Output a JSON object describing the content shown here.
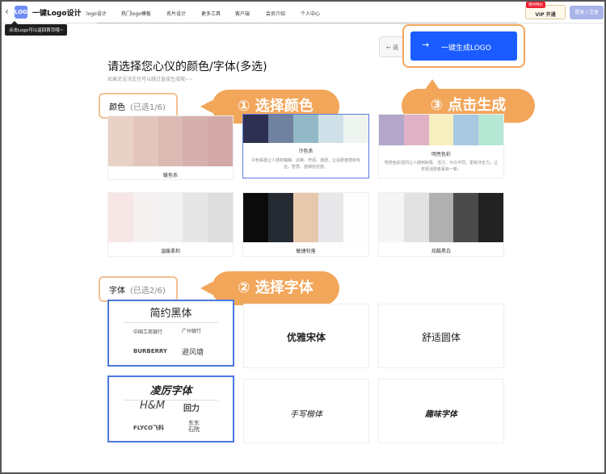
{
  "topbar": {
    "back": "‹",
    "logo_text": "LOGO",
    "brand": "一键Logo设计",
    "nav": [
      "logo设计",
      "热门logo模板",
      "名片设计",
      "更多工具",
      "客户端",
      "会员介绍",
      "个人中心"
    ],
    "tooltip": "点击Logo可以返回首页哦~",
    "vip_tag": "限时特价",
    "vip_label": "VIP 开通",
    "login": "登录 / 注册"
  },
  "actions": {
    "back": "← 返",
    "generate_arrow": "→",
    "generate": "一键生成LOGO"
  },
  "heading": {
    "title": "请选择您心仪的颜色/字体(多选)",
    "subtitle": "如果还没决定也可以跳过直接生成哦~~"
  },
  "color_section": {
    "label": "颜色",
    "count": "(已选1/6)",
    "callout": "① 选择颜色"
  },
  "font_section": {
    "label": "字体",
    "count": "(已选2/6)",
    "callout": "② 选择字体"
  },
  "generate_callout": "③ 点击生成",
  "color_cards": [
    {
      "name": "暖色系",
      "desc": "",
      "selected": false,
      "colors": [
        "#e8d2c5",
        "#e2c6bc",
        "#dbbab4",
        "#d6b0ad",
        "#d3a9a8"
      ]
    },
    {
      "name": "冷色系",
      "desc": "冷色系能让人感到镇静、凉爽、开阔、通透，让消费者感到专业、智慧、值得信任度。",
      "selected": true,
      "colors": [
        "#2d3050",
        "#6f82a0",
        "#93b9c9",
        "#cfe0e8",
        "#eef5f0"
      ]
    },
    {
      "name": "明亮色彩",
      "desc": "明亮色彩强烈让人感到积极、活力、与众不同，更有冲击力，让年轻消费者耳目一新。",
      "selected": false,
      "colors": [
        "#b3a6cb",
        "#e0b1c5",
        "#f6efc0",
        "#a9c8e2",
        "#b6e6d4"
      ]
    },
    {
      "name": "温暖柔和",
      "desc": "",
      "selected": false,
      "colors": [
        "#f7e6e6",
        "#f6f2f1",
        "#f2f2f2",
        "#e6e6e6",
        "#dddddd"
      ]
    },
    {
      "name": "敏捷利落",
      "desc": "",
      "selected": false,
      "colors": [
        "#0b0b0b",
        "#252a33",
        "#e8c8ad",
        "#e8e8ea",
        "#fdfdfd"
      ]
    },
    {
      "name": "炫酷黑白",
      "desc": "",
      "selected": false,
      "colors": [
        "#f5f5f5",
        "#e2e2e2",
        "#b0b0b0",
        "#4a4a4a",
        "#222222"
      ]
    }
  ],
  "font_cards": [
    {
      "name": "简约黑体",
      "selected": true,
      "brands": [
        "中国工商银行",
        "广州银行",
        "BURBERRY",
        "避风塘"
      ]
    },
    {
      "name": "优雅宋体",
      "selected": false,
      "brands": []
    },
    {
      "name": "舒适圆体",
      "selected": false,
      "brands": []
    },
    {
      "name": "凌厉字体",
      "selected": true,
      "brands": [
        "H&M",
        "回力",
        "FLYCO飞科",
        "东东石院"
      ]
    },
    {
      "name": "手写楷体",
      "selected": false,
      "brands": []
    },
    {
      "name": "趣味字体",
      "selected": false,
      "brands": []
    }
  ]
}
